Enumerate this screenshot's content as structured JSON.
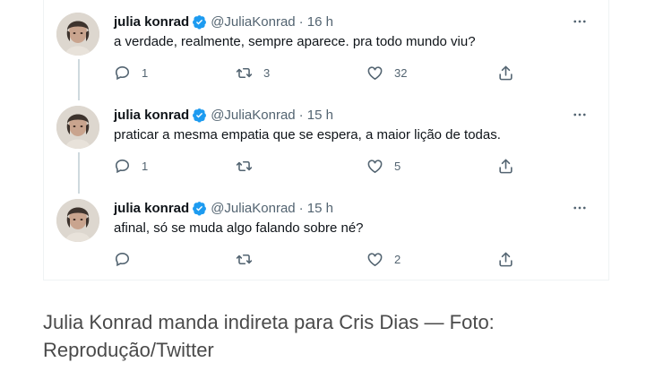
{
  "tweets": [
    {
      "name": "julia konrad",
      "handle": "@JuliaKonrad",
      "time": "· 16 h",
      "text": "a verdade, realmente, sempre aparece. pra todo mundo viu?",
      "replies": "1",
      "retweets": "3",
      "likes": "32"
    },
    {
      "name": "julia konrad",
      "handle": "@JuliaKonrad",
      "time": "· 15 h",
      "text": "praticar a mesma empatia que se espera, a maior lição de todas.",
      "replies": "1",
      "retweets": "",
      "likes": "5"
    },
    {
      "name": "julia konrad",
      "handle": "@JuliaKonrad",
      "time": "· 15 h",
      "text": "afinal, só se muda algo falando sobre né?",
      "replies": "",
      "retweets": "",
      "likes": "2"
    }
  ],
  "caption": "Julia Konrad manda indireta para Cris Dias — Foto: Reprodução/Twitter",
  "colors": {
    "verified": "#1d9bf0",
    "secondary_text": "#536471",
    "primary_text": "#0f1419"
  }
}
